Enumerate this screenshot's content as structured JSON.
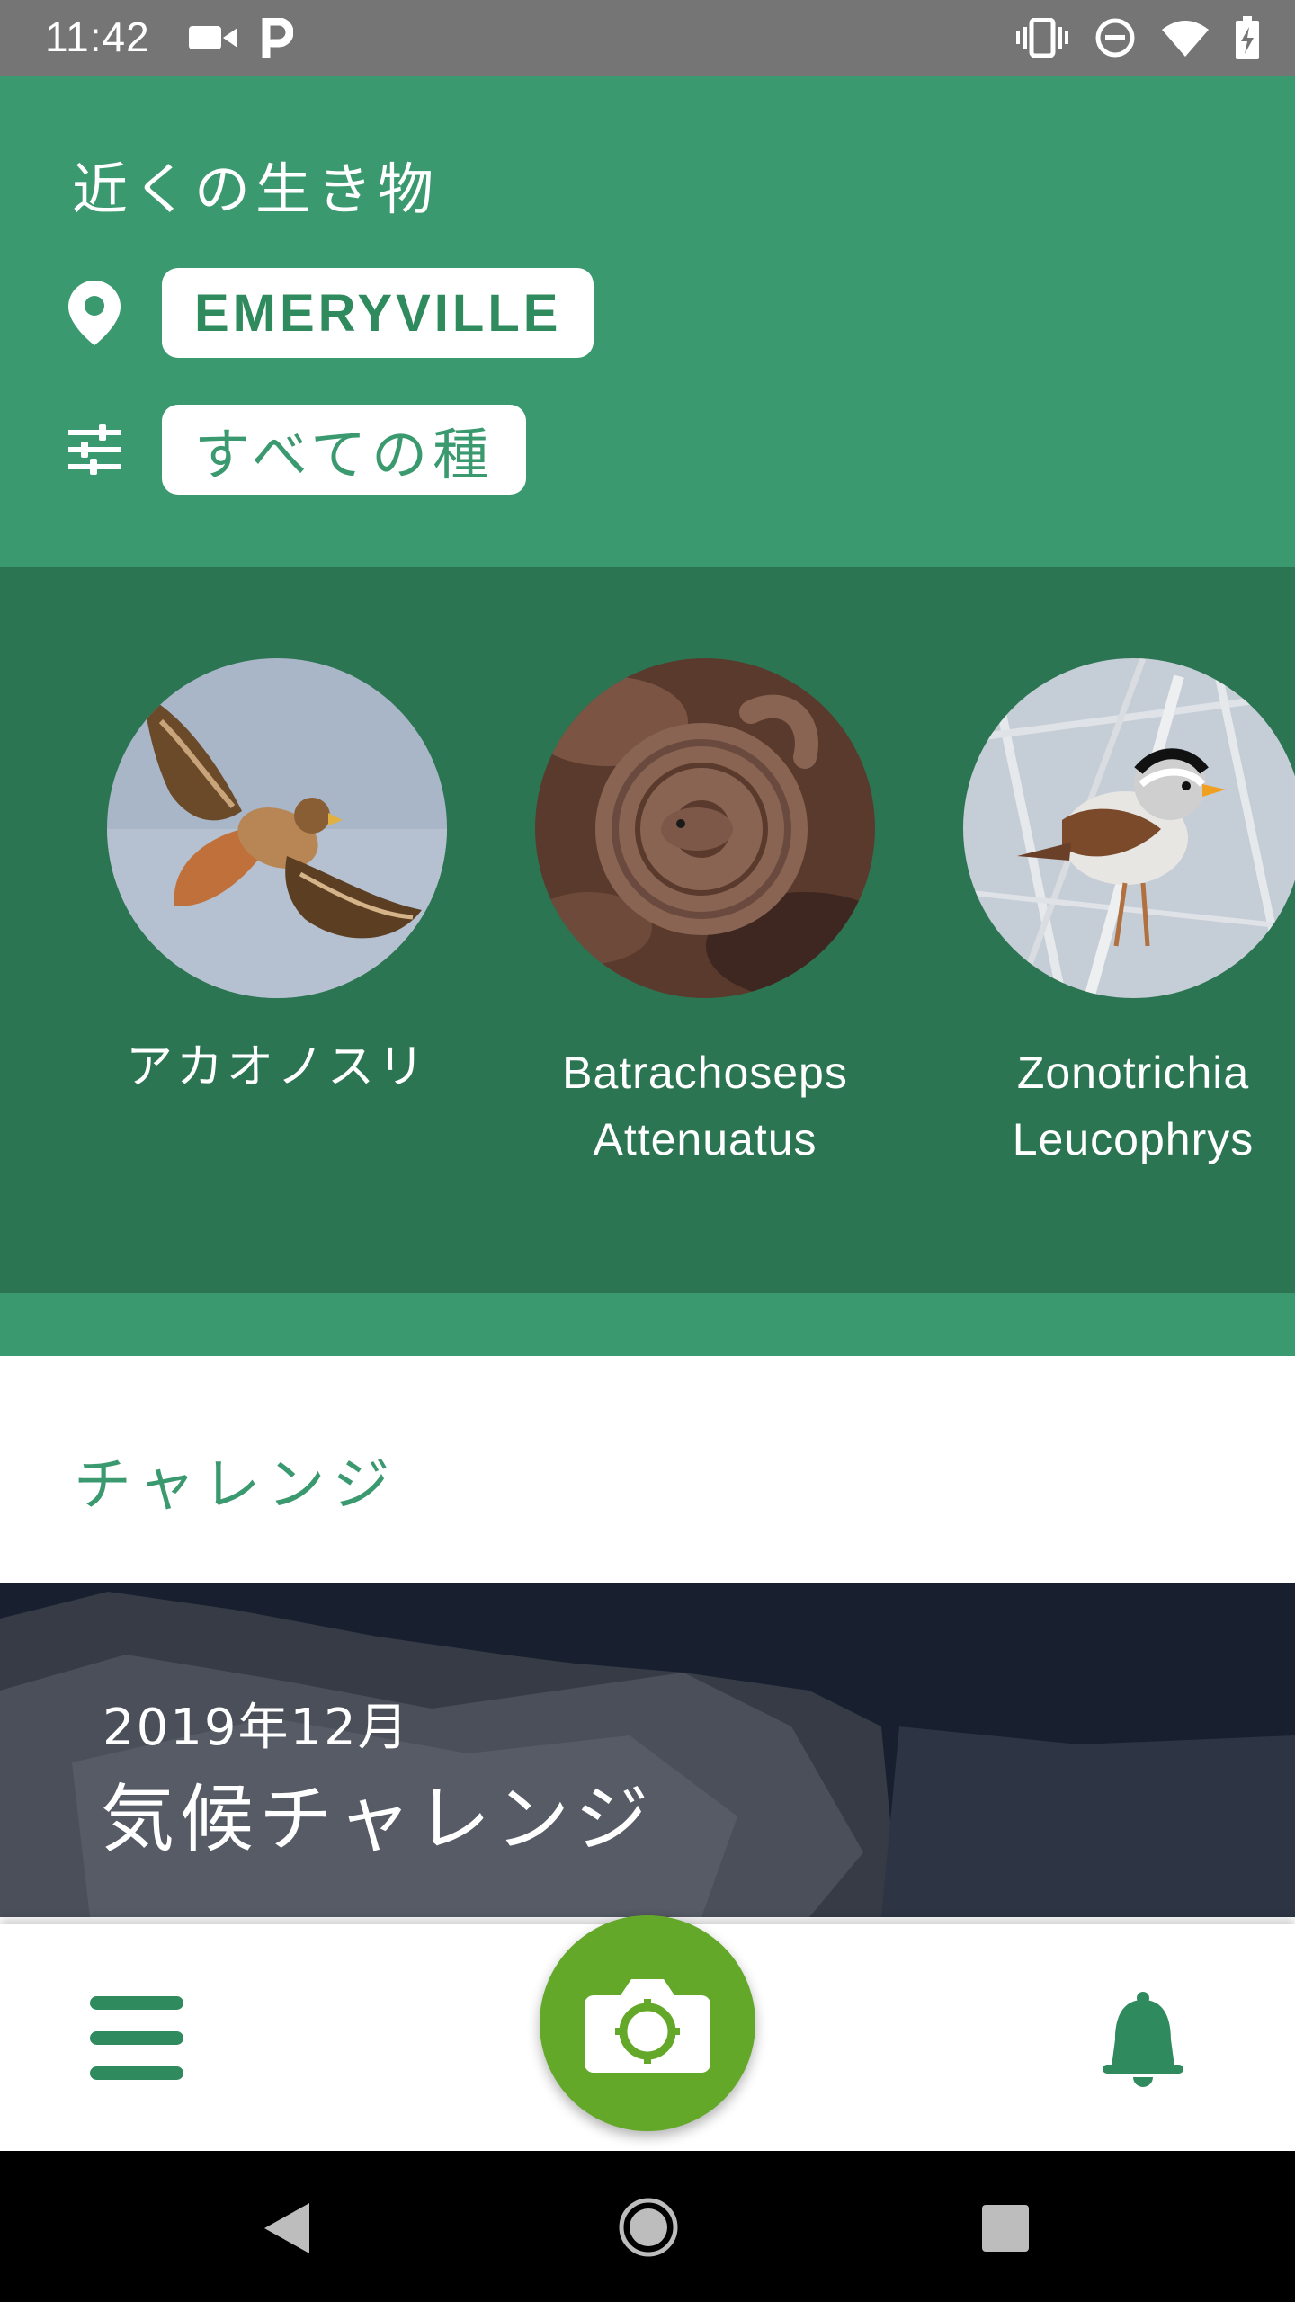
{
  "status_bar": {
    "time": "11:42",
    "left_icons": [
      "video-camera-icon",
      "parking-icon"
    ],
    "right_icons": [
      "vibrate-icon",
      "do-not-disturb-icon",
      "wifi-icon",
      "battery-charging-icon"
    ]
  },
  "header": {
    "title": "近くの生き物",
    "location_label": "EMERYVILLE",
    "filter_label": "すべての種",
    "background_color": "#3b9970"
  },
  "species": [
    {
      "name": "アカオノスリ",
      "photo": "red-tailed-hawk"
    },
    {
      "name_line1": "Batrachoseps",
      "name_line2": "Attenuatus",
      "photo": "slender-salamander"
    },
    {
      "name_line1": "Zonotrichia",
      "name_line2": "Leucophrys",
      "photo": "white-crowned-sparrow"
    }
  ],
  "challenges": {
    "section_title": "チャレンジ",
    "banner_date": "2019年12月",
    "banner_title": "気候チャレンジ"
  },
  "bottom_bar": {
    "menu_icon": "hamburger-menu-icon",
    "camera_icon": "camera-icon",
    "notifications_icon": "bell-icon",
    "camera_color": "#64a82a"
  },
  "nav_bar": {
    "buttons": [
      "back-icon",
      "home-icon",
      "recent-apps-icon"
    ]
  }
}
